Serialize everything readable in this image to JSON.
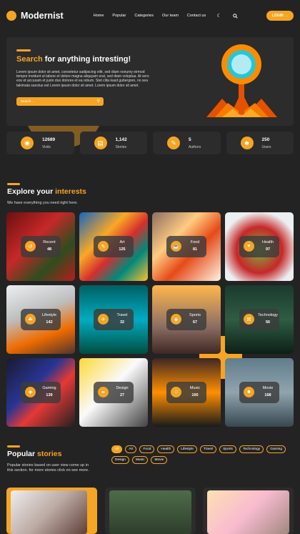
{
  "header": {
    "logo": "Modernist",
    "nav": [
      "Home",
      "Popular",
      "Categories",
      "Our team",
      "Contact us"
    ],
    "login": "LOGIN →"
  },
  "hero": {
    "title_accent": "Search",
    "title_rest": " for anything intresting!",
    "text": "Lorem ipsum dolor sit amet, consetetur sadipscing elitr, sed diam nonumy eirmod tempor invidunt ut labore et dolore magna aliquyam erat, sed diam voluptua. At vero eos et accusam et justo duo dolores et ea rebum. Stet clita kasd gubergren, no sea takimata sanctus est Lorem ipsum dolor sit amet. Lorem ipsum dolor sit amet.",
    "search_placeholder": "Search..."
  },
  "stats": [
    {
      "value": "12689",
      "label": "Visits",
      "icon": "eye-icon"
    },
    {
      "value": "1,142",
      "label": "Stories",
      "icon": "newspaper-icon"
    },
    {
      "value": "5",
      "label": "Authors",
      "icon": "pen-icon"
    },
    {
      "value": "250",
      "label": "Users",
      "icon": "users-icon"
    }
  ],
  "explore": {
    "title_plain": "Explore your ",
    "title_accent": "interests",
    "subtitle": "We have everything you need right here."
  },
  "categories": [
    {
      "label": "Recent",
      "count": "48",
      "icon": "history-icon",
      "bg": "linear-gradient(135deg,#6b1010,#c62828 40%,#2e4d1e 70%,#b71c1c)"
    },
    {
      "label": "Art",
      "count": "125",
      "icon": "brush-icon",
      "bg": "linear-gradient(135deg,#1565c0,#f9a825 35%,#d32f2f 55%,#00897b 75%,#fbc02d)"
    },
    {
      "label": "Food",
      "count": "81",
      "icon": "food-icon",
      "bg": "linear-gradient(135deg,#8d6e63,#ffcc80 35%,#e64a19 60%,#fff3e0)"
    },
    {
      "label": "Health",
      "count": "97",
      "icon": "heart-icon",
      "bg": "radial-gradient(circle at 50% 55%,#7cb342,#c62828 45%,#eceff1 75%)"
    },
    {
      "label": "Lifestyle",
      "count": "142",
      "icon": "leaf-icon",
      "bg": "linear-gradient(160deg,#eceff1,#bdbdbd 40%,#ef6c00 70%,#4e342e)"
    },
    {
      "label": "Travel",
      "count": "32",
      "icon": "plane-icon",
      "bg": "linear-gradient(180deg,#006064,#00acc1 50%,#004d40)"
    },
    {
      "label": "Sports",
      "count": "67",
      "icon": "ball-icon",
      "bg": "linear-gradient(180deg,#ffb74d,#8d6e63 60%,#3e2723)"
    },
    {
      "label": "Technology",
      "count": "56",
      "icon": "chip-icon",
      "bg": "linear-gradient(180deg,#1b3a2e,#2e5d43 50%,#0d1f17)"
    },
    {
      "label": "Gaming",
      "count": "139",
      "icon": "gamepad-icon",
      "bg": "linear-gradient(135deg,#1a1a2e,#283593 40%,#e53935 60%,#212121)"
    },
    {
      "label": "Design",
      "count": "27",
      "icon": "pen-tool-icon",
      "bg": "linear-gradient(135deg,#fdd835,#fafafa 45%,#424242)"
    },
    {
      "label": "Music",
      "count": "160",
      "icon": "headphones-icon",
      "bg": "linear-gradient(180deg,#3e2723,#ff8f00 50%,#1a1a1a)"
    },
    {
      "label": "Movie",
      "count": "168",
      "icon": "camera-icon",
      "bg": "linear-gradient(180deg,#607d8b,#90a4ae 50%,#37474f)"
    }
  ],
  "popular": {
    "title_plain": "Popular ",
    "title_accent": "stories",
    "subtitle": "Popular stories based on user view come up in this section. for more stories click on see more.",
    "filters": [
      "All",
      "Art",
      "Food",
      "Health",
      "Lifestyle",
      "Travel",
      "Sports",
      "Technology",
      "Gaming",
      "Design",
      "Music",
      "Movie"
    ],
    "active_filter": "All"
  },
  "colors": {
    "accent": "#f5a524",
    "bg": "#232323",
    "card": "#2c2c2c"
  }
}
